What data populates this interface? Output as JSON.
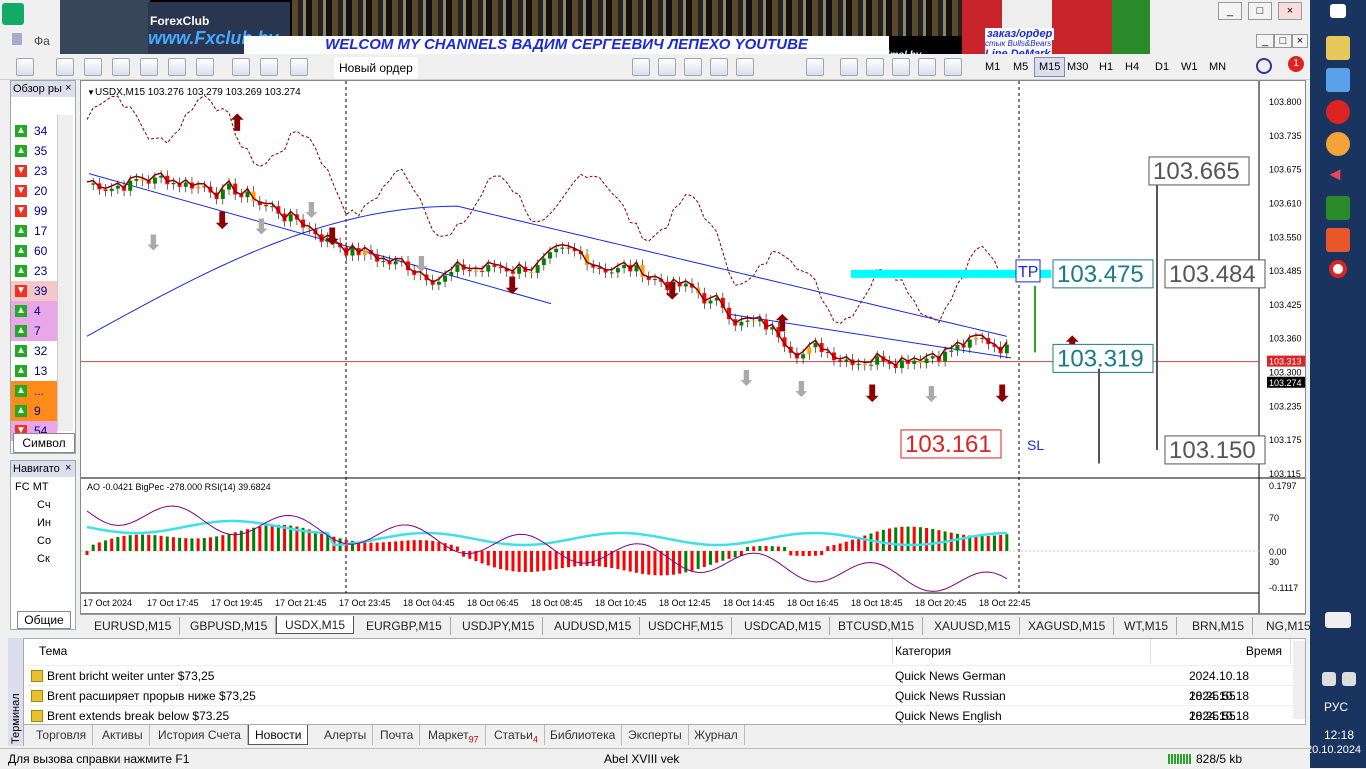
{
  "menubar": {
    "items": [
      "Фа"
    ]
  },
  "banner": {
    "brand_small": "ForexClub",
    "brand_url": "www.Fxclub.by",
    "welcome": "WELCOM MY CHANNELS ВАДИМ СЕРГЕЕВИЧ ЛЕПЕХО YOUTUBE",
    "url": "www.wildforexvadzimsl.by",
    "order": "заказ/ордер",
    "order_sub": "стык Bulls&Bears",
    "order_line": "Line DeMark"
  },
  "toolbar": {
    "new_order": "Новый ордер",
    "timeframes": [
      "M1",
      "M5",
      "M15",
      "M30",
      "H1",
      "H4",
      "D1",
      "W1",
      "MN"
    ],
    "active_tf": "M15",
    "notif_count": "1"
  },
  "window_buttons": [
    "_",
    "□",
    "×"
  ],
  "market_watch": {
    "header": "Обзор ры",
    "tab": "Символ",
    "rows": [
      {
        "dir": "up",
        "val": "34"
      },
      {
        "dir": "up",
        "val": "35"
      },
      {
        "dir": "down",
        "val": "23"
      },
      {
        "dir": "down",
        "val": "20"
      },
      {
        "dir": "down",
        "val": "99"
      },
      {
        "dir": "up",
        "val": "17"
      },
      {
        "dir": "up",
        "val": "60"
      },
      {
        "dir": "up",
        "val": "23"
      },
      {
        "dir": "down",
        "val": "39"
      },
      {
        "dir": "up",
        "val": "4"
      },
      {
        "dir": "up",
        "val": "7"
      },
      {
        "dir": "up",
        "val": "32"
      },
      {
        "dir": "up",
        "val": "13"
      },
      {
        "dir": "up",
        "val": "..."
      },
      {
        "dir": "up",
        "val": "9"
      },
      {
        "dir": "down",
        "val": "54"
      }
    ]
  },
  "navigator": {
    "header": "Навигато",
    "items": [
      "FC MT",
      "Сч",
      "Ин",
      "Со",
      "Ск"
    ],
    "tab": "Общие"
  },
  "chart": {
    "symbol_label": "USDX,M15  103.276 103.279 103.269 103.274",
    "indicator_label": "AO -0.0421  BigPec -278.000  RSI(14) 39.6824",
    "price_axis": [
      "103.800",
      "103.735",
      "103.675",
      "103.610",
      "103.550",
      "103.485",
      "103.425",
      "103.360",
      "103.300",
      "103.235",
      "103.175",
      "103.115"
    ],
    "current_price": "103.274",
    "red_line_price": "103.313",
    "sub_axis": [
      "0.1797",
      "70",
      "0.00",
      "30",
      "-0.1117"
    ],
    "time_axis": [
      "17 Oct 2024",
      "17 Oct 17:45",
      "17 Oct 19:45",
      "17 Oct 21:45",
      "17 Oct 23:45",
      "18 Oct 04:45",
      "18 Oct 06:45",
      "18 Oct 08:45",
      "18 Oct 10:45",
      "18 Oct 12:45",
      "18 Oct 14:45",
      "18 Oct 16:45",
      "18 Oct 18:45",
      "18 Oct 20:45",
      "18 Oct 22:45"
    ],
    "labels": {
      "tp": "TP",
      "sl": "SL",
      "tp_price": "103.475",
      "entry_price": "103.319",
      "sl_price": "103.161",
      "box_high": "103.665",
      "box_mid": "103.484",
      "box_low": "103.150"
    },
    "colors": {
      "bull": "#008000",
      "bear": "#ff0000",
      "orange": "#ffa500",
      "ma_blue": "#1a2ad8",
      "ma_red": "#8b0000",
      "ao_cyan": "#40e0e8",
      "rsi": "#800080",
      "tp_zone": "#00ffff"
    }
  },
  "chart_tabs": [
    "EURUSD,M15",
    "GBPUSD,M15",
    "USDX,M15",
    "EURGBP,M15",
    "USDJPY,M15",
    "AUDUSD,M15",
    "USDCHF,M15",
    "USDCAD,M15",
    "BTCUSD,M15",
    "XAUUSD,M15",
    "XAGUSD,M15",
    "WT,M15",
    "BRN,M15",
    "NG,M15"
  ],
  "active_chart_tab": "USDX,M15",
  "terminal": {
    "side_label": "Терминал",
    "columns": [
      "Тема",
      "Категория",
      "Время"
    ],
    "rows": [
      {
        "subject": "Brent bricht weiter unter $73,25",
        "category": "Quick News German",
        "time": "2024.10.18 18:25:55"
      },
      {
        "subject": "Brent расширяет прорыв ниже $73,25",
        "category": "Quick News Russian",
        "time": "2024.10.18 18:25:55"
      },
      {
        "subject": "Brent extends break below $73.25",
        "category": "Quick News English",
        "time": "2024.10.18 18:25:55"
      }
    ],
    "tabs": [
      {
        "label": "Торговля"
      },
      {
        "label": "Активы"
      },
      {
        "label": "История Счета"
      },
      {
        "label": "Новости",
        "active": true
      },
      {
        "label": "Алерты"
      },
      {
        "label": "Почта"
      },
      {
        "label": "Маркет",
        "badge": "97"
      },
      {
        "label": "Статьи",
        "badge": "4"
      },
      {
        "label": "Библиотека"
      },
      {
        "label": "Эксперты"
      },
      {
        "label": "Журнал"
      }
    ]
  },
  "status": {
    "help": "Для вызова справки нажмите F1",
    "profile": "Abel XVIII vek",
    "traffic": "828/5 kb"
  },
  "taskbar": {
    "lang": "РУС",
    "time": "12:18",
    "date": "20.10.2024"
  }
}
